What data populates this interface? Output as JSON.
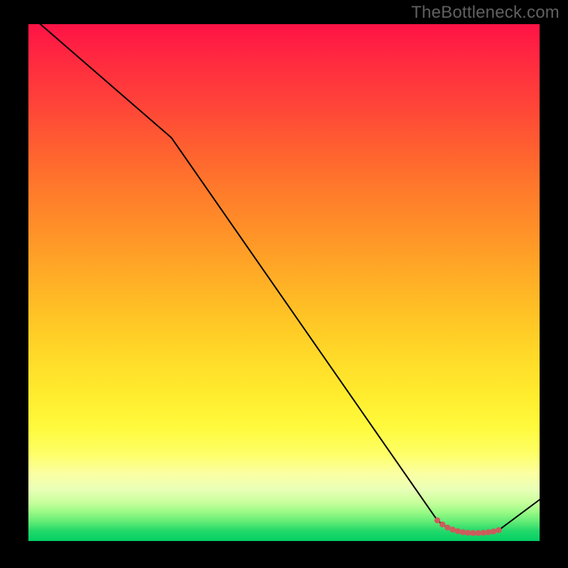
{
  "watermark": "TheBottleneck.com",
  "chart_data": {
    "type": "line",
    "title": "",
    "xlabel": "",
    "ylabel": "",
    "xlim": [
      0,
      100
    ],
    "ylim": [
      0,
      100
    ],
    "series": [
      {
        "name": "curve",
        "x": [
          0,
          28,
          80,
          81,
          82,
          83,
          84,
          85,
          86,
          87,
          88,
          89,
          90,
          91,
          92,
          100
        ],
        "values": [
          102,
          78,
          4,
          3.2,
          2.6,
          2.2,
          1.9,
          1.7,
          1.6,
          1.55,
          1.55,
          1.6,
          1.7,
          1.85,
          2.1,
          8
        ]
      },
      {
        "name": "trough-markers",
        "x": [
          80,
          81,
          82,
          83,
          84,
          85,
          86,
          87,
          88,
          89,
          90,
          91,
          92
        ],
        "values": [
          4,
          3.2,
          2.6,
          2.2,
          1.9,
          1.7,
          1.6,
          1.55,
          1.55,
          1.6,
          1.7,
          1.85,
          2.1
        ]
      }
    ],
    "colors": {
      "line": "#000000",
      "marker": "#cd5c5c"
    }
  }
}
